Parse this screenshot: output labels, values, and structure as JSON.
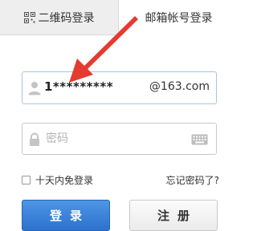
{
  "tabs": {
    "qr_label": "二维码登录",
    "email_label": "邮箱帐号登录"
  },
  "username": {
    "value": "1*********",
    "domain": "@163.com"
  },
  "password": {
    "placeholder": "密码"
  },
  "remember": {
    "label": "十天内免登录",
    "checked": false
  },
  "forgot_label": "忘记密码了?",
  "login_label": "登录",
  "register_label": "注册",
  "colors": {
    "accent": "#2c72cf",
    "arrow": "#e53a30"
  }
}
